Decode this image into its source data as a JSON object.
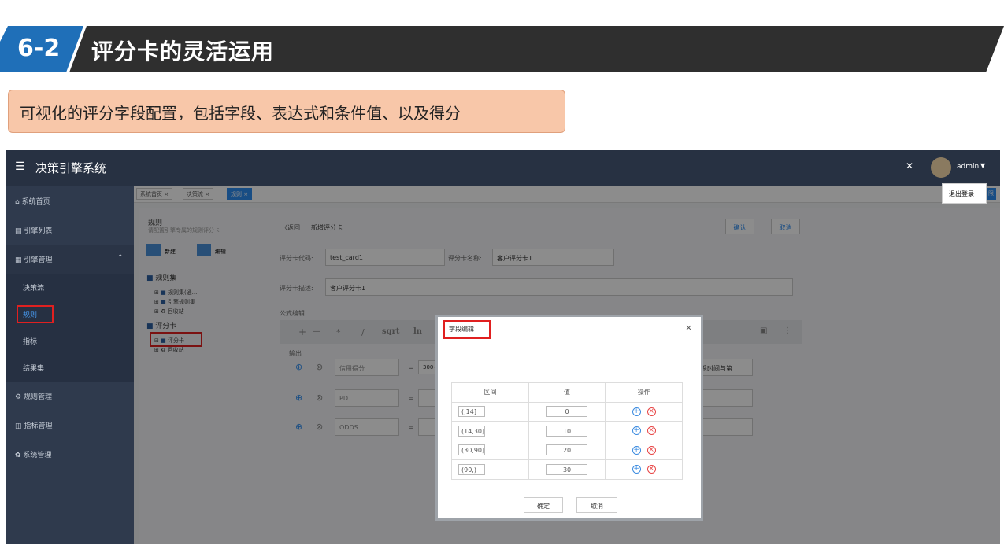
{
  "slide": {
    "section_number": "6-2",
    "title": "评分卡的灵活运用",
    "callout": "可视化的评分字段配置，包括字段、表达式和条件值、以及得分"
  },
  "app": {
    "brand": "决策引擎系统",
    "user": "admin",
    "logout": "退出登录",
    "tab_overflow": "限"
  },
  "sidebar": {
    "items": [
      {
        "label": "系统首页",
        "icon": "home-icon"
      },
      {
        "label": "引擎列表",
        "icon": "list-icon"
      },
      {
        "label": "引擎管理",
        "icon": "apps-icon"
      },
      {
        "label": "决策流",
        "icon": ""
      },
      {
        "label": "规则",
        "icon": ""
      },
      {
        "label": "指标",
        "icon": ""
      },
      {
        "label": "结果集",
        "icon": ""
      },
      {
        "label": "规则管理",
        "icon": "gear-icon"
      },
      {
        "label": "指标管理",
        "icon": "book-icon"
      },
      {
        "label": "系统管理",
        "icon": "settings-icon"
      }
    ]
  },
  "tabs": [
    {
      "label": "系统首页 ×"
    },
    {
      "label": "决策流 ×"
    },
    {
      "label": "规则 ×"
    }
  ],
  "tree": {
    "title": "规则",
    "subtitle": "请配置引擎专属的规则评分卡",
    "new_label": "新建",
    "edit_label": "编辑",
    "ruleset": "规则集",
    "ruleset_children": [
      "规则集(通...",
      "引擎规则集",
      "回收站"
    ],
    "scorecard": "评分卡",
    "scorecard_children": [
      "评分卡",
      "回收站"
    ]
  },
  "form": {
    "back": "〈返回",
    "heading": "新增评分卡",
    "confirm": "确认",
    "cancel": "取消",
    "code_label": "评分卡代码:",
    "code_value": "test_card1",
    "name_label": "评分卡名称:",
    "name_value": "客户评分卡1",
    "desc_label": "评分卡描述:",
    "desc_value": "客户评分卡1",
    "formula_label": "公式编辑",
    "toolbar": [
      "+",
      "—",
      "*",
      "/",
      "sqrt",
      "ln"
    ],
    "output_label": "输出",
    "outputs": [
      {
        "name": "信用得分",
        "expr": "300+6"
      },
      {
        "name": "PD",
        "expr": ""
      },
      {
        "name": "ODDS",
        "expr": ""
      }
    ],
    "right_field_text": "系时间与第"
  },
  "dialog": {
    "title": "字段编辑",
    "headers": [
      "区间",
      "值",
      "操作"
    ],
    "rows": [
      {
        "interval": "(,14]",
        "value": "0"
      },
      {
        "interval": "(14,30]",
        "value": "10"
      },
      {
        "interval": "(30,90]",
        "value": "20"
      },
      {
        "interval": "(90,)",
        "value": "30"
      }
    ],
    "ok": "确定",
    "cancel": "取消"
  },
  "colors": {
    "banner_dark": "#2f2f2f",
    "banner_accent": "#1f6fb8",
    "callout_bg": "#f8c7a9",
    "topbar": "#273142",
    "sidebar": "#2f3a4d",
    "highlight_red": "#e02020",
    "add_blue": "#3b8be0",
    "remove_red": "#e84545"
  }
}
